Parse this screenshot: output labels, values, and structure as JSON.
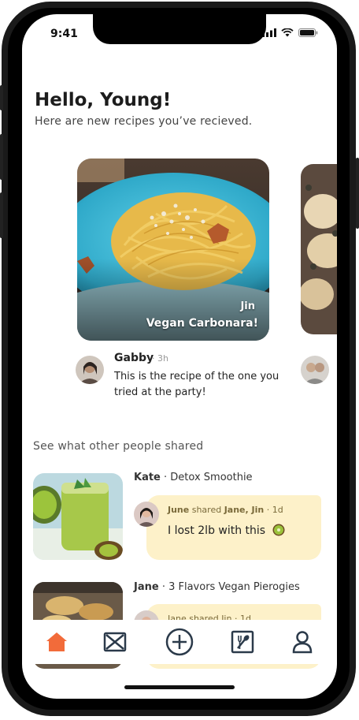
{
  "status_bar": {
    "time": "9:41"
  },
  "header": {
    "greeting": "Hello, Young!",
    "subtitle": "Here are new recipes you’ve recieved."
  },
  "received_recipe": {
    "sender": "Jin",
    "title": "Vegan Carbonara!"
  },
  "message": {
    "author": "Gabby",
    "separator": "·",
    "time": "3h",
    "text": "This is the recipe of the one you tried at the party!"
  },
  "section": {
    "title": "See what other people shared"
  },
  "feed": [
    {
      "author": "Kate",
      "recipe": "Detox Smoothie",
      "share_by": "June",
      "share_verb": "shared",
      "share_to": "Jane, Jin",
      "share_time": "1d",
      "comment": "I lost 2lb with this"
    },
    {
      "author": "Jane",
      "recipe": "3 Flavors Vegan Pierogies",
      "share_meta": "Jane shared Jin · 1d"
    }
  ],
  "tabbar": {
    "active_color": "#f26b3a",
    "icon_color": "#2b3a4a",
    "tabs": [
      "home-icon",
      "inbox-icon",
      "add-icon",
      "recipe-book-icon",
      "profile-icon"
    ]
  }
}
